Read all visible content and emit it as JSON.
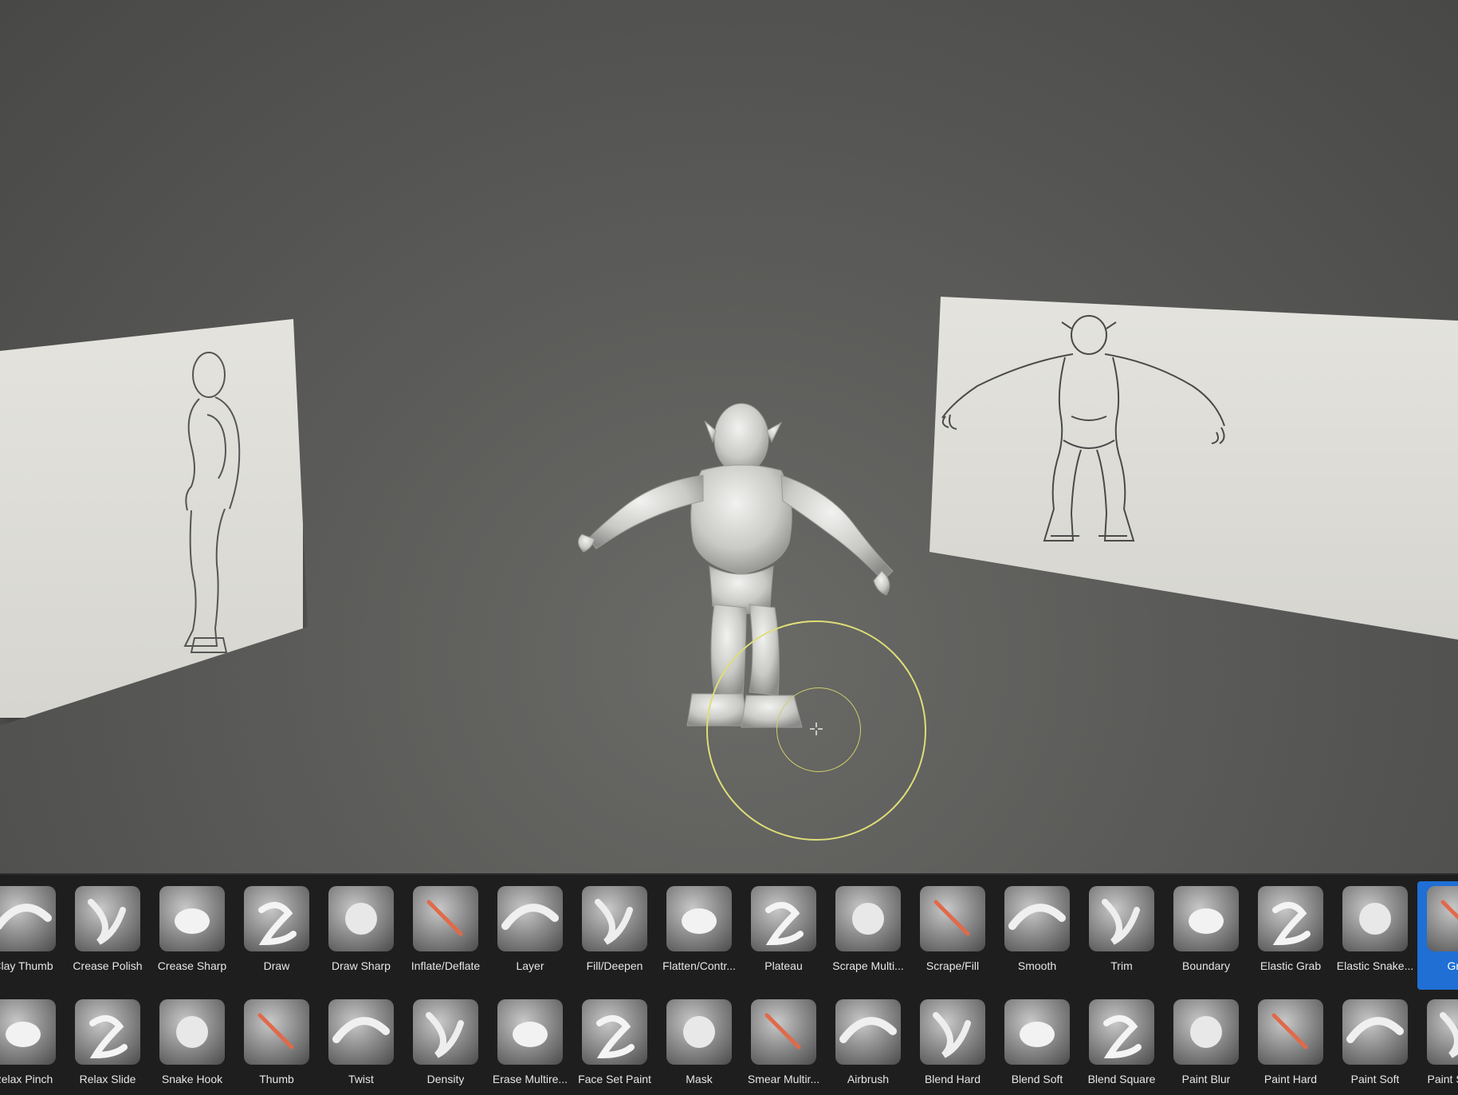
{
  "app": {
    "accent_color": "#1f6fd4",
    "cursor_color": "#dede78"
  },
  "toolbar": {
    "row1": [
      {
        "label": "Clay Thumb",
        "icon": "clay-thumb-brush-icon"
      },
      {
        "label": "Crease Polish",
        "icon": "crease-polish-brush-icon"
      },
      {
        "label": "Crease Sharp",
        "icon": "crease-sharp-brush-icon"
      },
      {
        "label": "Draw",
        "icon": "draw-brush-icon"
      },
      {
        "label": "Draw Sharp",
        "icon": "draw-sharp-brush-icon"
      },
      {
        "label": "Inflate/Deflate",
        "icon": "inflate-deflate-brush-icon"
      },
      {
        "label": "Layer",
        "icon": "layer-brush-icon"
      },
      {
        "label": "Fill/Deepen",
        "icon": "fill-deepen-brush-icon"
      },
      {
        "label": "Flatten/Contr...",
        "icon": "flatten-contrast-brush-icon"
      },
      {
        "label": "Plateau",
        "icon": "plateau-brush-icon"
      },
      {
        "label": "Scrape Multi...",
        "icon": "scrape-multiplane-brush-icon"
      },
      {
        "label": "Scrape/Fill",
        "icon": "scrape-fill-brush-icon"
      },
      {
        "label": "Smooth",
        "icon": "smooth-brush-icon"
      },
      {
        "label": "Trim",
        "icon": "trim-brush-icon"
      },
      {
        "label": "Boundary",
        "icon": "boundary-brush-icon"
      },
      {
        "label": "Elastic Grab",
        "icon": "elastic-grab-brush-icon"
      },
      {
        "label": "Elastic Snake...",
        "icon": "elastic-snake-hook-brush-icon"
      },
      {
        "label": "Grab",
        "icon": "grab-brush-icon",
        "selected": true
      }
    ],
    "row2": [
      {
        "label": "Relax Pinch",
        "icon": "relax-pinch-brush-icon"
      },
      {
        "label": "Relax Slide",
        "icon": "relax-slide-brush-icon"
      },
      {
        "label": "Snake Hook",
        "icon": "snake-hook-brush-icon"
      },
      {
        "label": "Thumb",
        "icon": "thumb-brush-icon"
      },
      {
        "label": "Twist",
        "icon": "twist-brush-icon"
      },
      {
        "label": "Density",
        "icon": "density-brush-icon"
      },
      {
        "label": "Erase Multire...",
        "icon": "erase-multires-brush-icon"
      },
      {
        "label": "Face Set Paint",
        "icon": "face-set-paint-brush-icon"
      },
      {
        "label": "Mask",
        "icon": "mask-brush-icon"
      },
      {
        "label": "Smear Multir...",
        "icon": "smear-multires-brush-icon"
      },
      {
        "label": "Airbrush",
        "icon": "airbrush-brush-icon"
      },
      {
        "label": "Blend Hard",
        "icon": "blend-hard-brush-icon"
      },
      {
        "label": "Blend Soft",
        "icon": "blend-soft-brush-icon"
      },
      {
        "label": "Blend Square",
        "icon": "blend-square-brush-icon"
      },
      {
        "label": "Paint Blur",
        "icon": "paint-blur-brush-icon"
      },
      {
        "label": "Paint Hard",
        "icon": "paint-hard-brush-icon"
      },
      {
        "label": "Paint Soft",
        "icon": "paint-soft-brush-icon"
      },
      {
        "label": "Paint Square",
        "icon": "paint-square-brush-icon"
      }
    ]
  }
}
